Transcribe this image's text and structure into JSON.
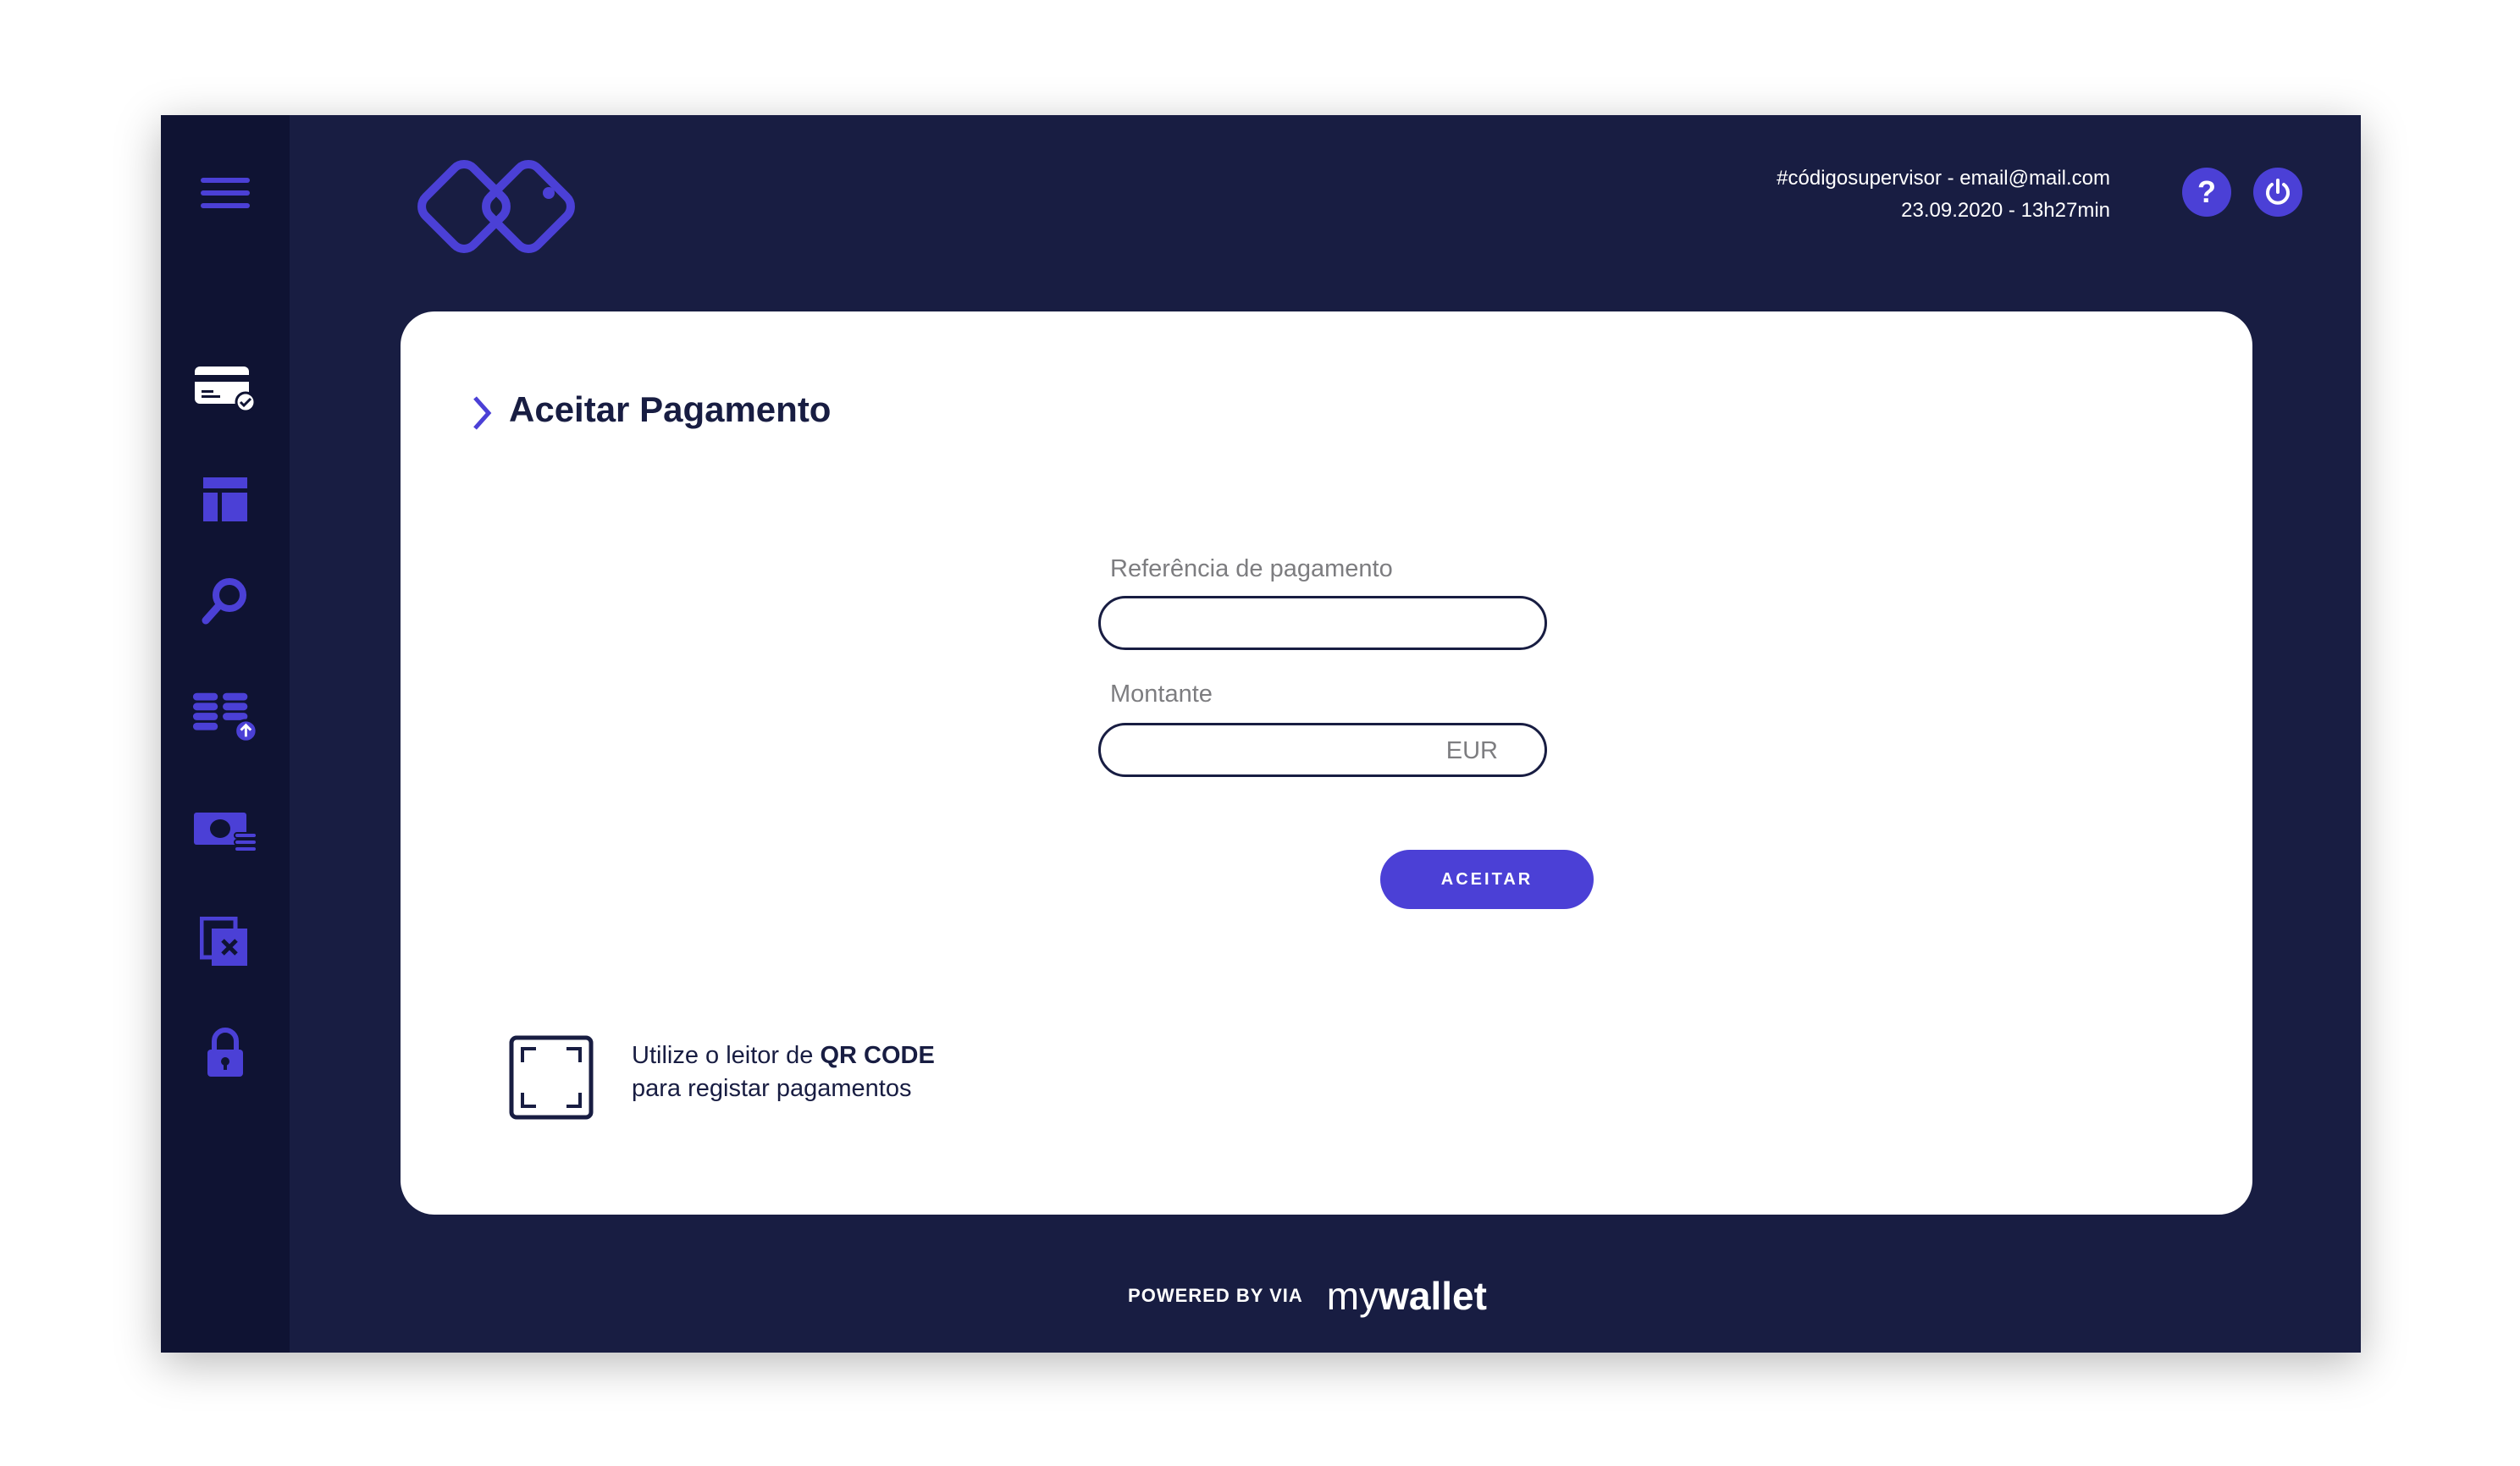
{
  "header": {
    "user_line": "#códigosupervisor - email@mail.com",
    "datetime_line": "23.09.2020 - 13h27min",
    "help_label": "?"
  },
  "sidebar": {
    "items": [
      {
        "icon": "card-check-icon"
      },
      {
        "icon": "layout-icon"
      },
      {
        "icon": "search-icon"
      },
      {
        "icon": "coins-icon"
      },
      {
        "icon": "cash-icon"
      },
      {
        "icon": "cancel-document-icon"
      },
      {
        "icon": "lock-icon"
      }
    ]
  },
  "page": {
    "title": "Aceitar Pagamento",
    "reference": {
      "label": "Referência de pagamento",
      "value": "",
      "placeholder": ""
    },
    "amount": {
      "label": "Montante",
      "value": "",
      "currency": "EUR"
    },
    "accept_label": "ACEITAR",
    "qr": {
      "line1_prefix": "Utilize o leitor de ",
      "line1_bold": "QR CODE",
      "line2": "para registar pagamentos"
    }
  },
  "footer": {
    "powered": "POWERED BY VIA",
    "brand_light": "my",
    "brand_bold": "wallet"
  },
  "colors": {
    "background": "#181d42",
    "sidebar": "#0f1333",
    "accent": "#4b40d6",
    "card": "#ffffff"
  }
}
